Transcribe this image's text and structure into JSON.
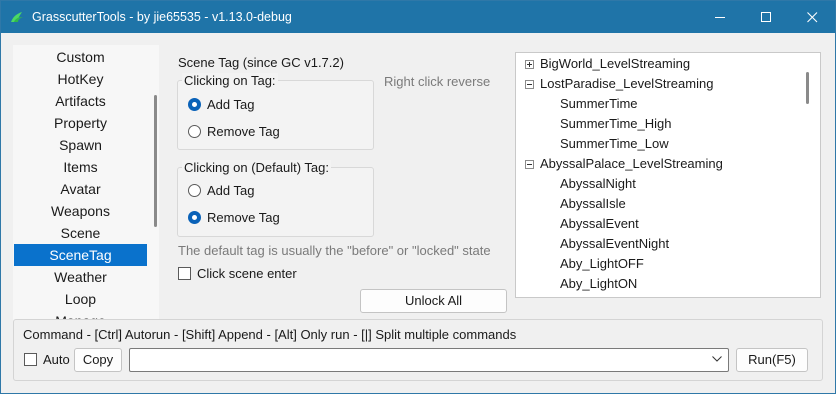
{
  "window": {
    "title": "GrasscutterTools  -  by jie65535  -  v1.13.0-debug",
    "titlebar_color": "#1f74a8",
    "controls": [
      "minimize-icon",
      "maximize-icon",
      "close-icon"
    ]
  },
  "sidebar": {
    "items": [
      {
        "label": "Custom"
      },
      {
        "label": "HotKey"
      },
      {
        "label": "Artifacts"
      },
      {
        "label": "Property"
      },
      {
        "label": "Spawn"
      },
      {
        "label": "Items"
      },
      {
        "label": "Avatar"
      },
      {
        "label": "Weapons"
      },
      {
        "label": "Scene"
      },
      {
        "label": "SceneTag",
        "selected": true
      },
      {
        "label": "Weather"
      },
      {
        "label": "Loop"
      },
      {
        "label": "Manage"
      }
    ],
    "accent": "#0a72cc"
  },
  "scene_tag": {
    "title": "Scene Tag (since GC v1.7.2)",
    "right_click_hint": "Right click reverse",
    "group_clicking": {
      "legend": "Clicking on Tag:",
      "options": [
        {
          "label": "Add Tag",
          "checked": true
        },
        {
          "label": "Remove Tag",
          "checked": false
        }
      ]
    },
    "group_default": {
      "legend": "Clicking on (Default) Tag:",
      "options": [
        {
          "label": "Add Tag",
          "checked": false
        },
        {
          "label": "Remove Tag",
          "checked": true
        }
      ]
    },
    "default_hint": "The default tag is usually the \"before\" or \"locked\" state",
    "click_scene_enter": {
      "label": "Click scene enter",
      "checked": false
    },
    "unlock_all_label": "Unlock All"
  },
  "tree": {
    "rows": [
      {
        "label": "BigWorld_LevelStreaming",
        "level": 0,
        "expander": "plus"
      },
      {
        "label": "LostParadise_LevelStreaming",
        "level": 0,
        "expander": "minus"
      },
      {
        "label": "SummerTime",
        "level": 1
      },
      {
        "label": "SummerTime_High",
        "level": 1
      },
      {
        "label": "SummerTime_Low",
        "level": 1
      },
      {
        "label": "AbyssalPalace_LevelStreaming",
        "level": 0,
        "expander": "minus"
      },
      {
        "label": "AbyssalNight",
        "level": 1
      },
      {
        "label": "AbyssalIsle",
        "level": 1
      },
      {
        "label": "AbyssalEvent",
        "level": 1
      },
      {
        "label": "AbyssalEventNight",
        "level": 1
      },
      {
        "label": "Aby_LightOFF",
        "level": 1
      },
      {
        "label": "Aby_LightON",
        "level": 1
      }
    ]
  },
  "command": {
    "help": "Command   - [Ctrl] Autorun   - [Shift] Append   - [Alt] Only run   - [|] Split multiple commands",
    "auto_label": "Auto",
    "auto_checked": false,
    "copy_label": "Copy",
    "input_value": "",
    "run_label": "Run(F5)"
  }
}
